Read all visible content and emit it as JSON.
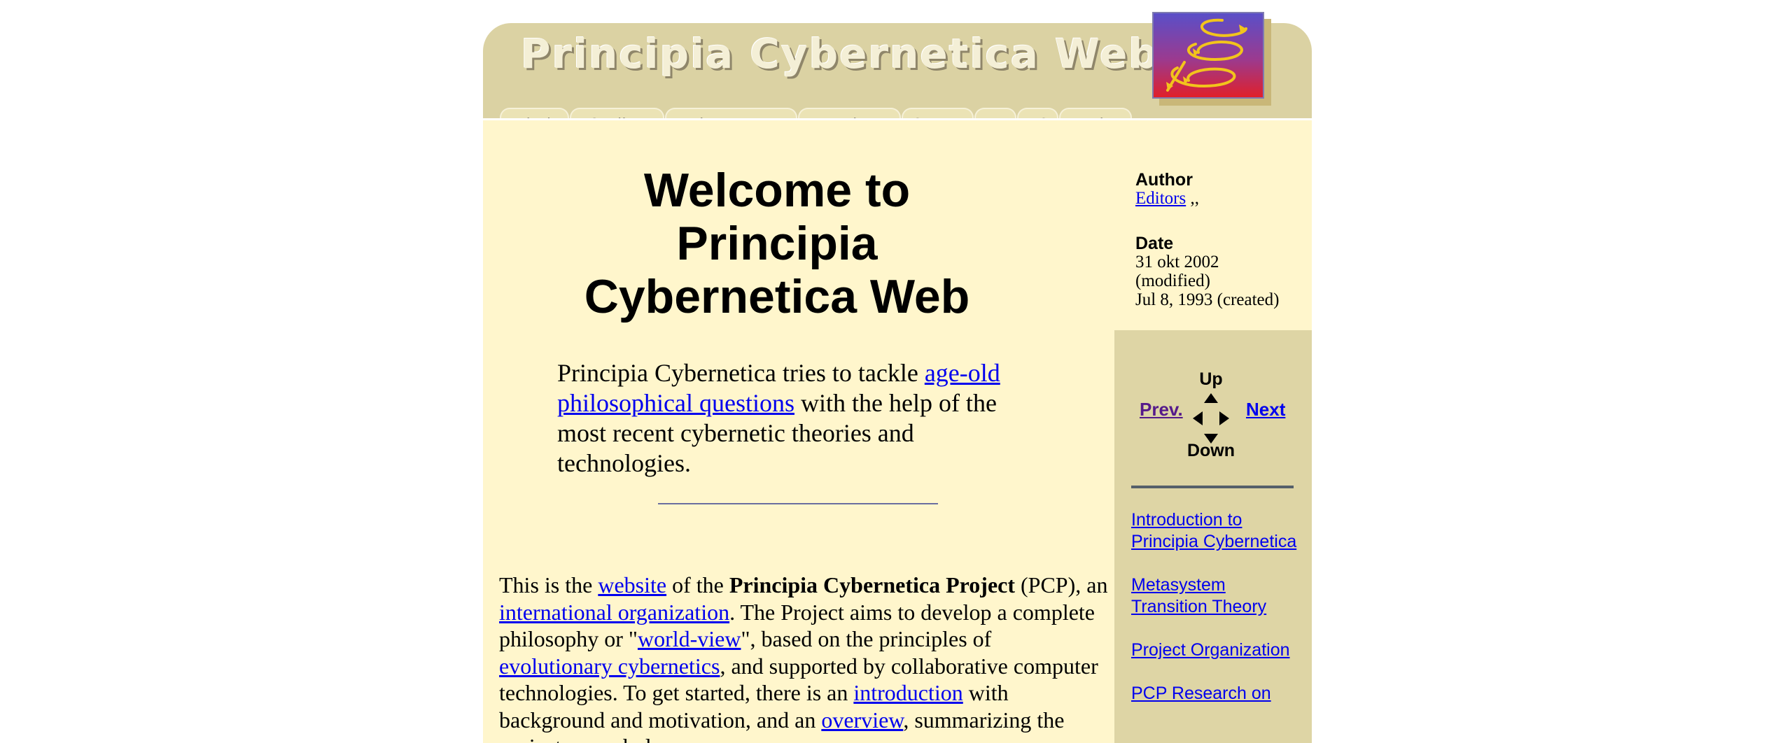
{
  "header": {
    "banner_title": "Principia Cybernetica Web",
    "tabs": [
      {
        "label": "Find",
        "style": "normal"
      },
      {
        "label": "Outline",
        "style": "normal"
      },
      {
        "label": "What's New",
        "style": "normal"
      },
      {
        "label": "Random",
        "style": "normal"
      },
      {
        "label": "Server",
        "style": "italic"
      },
      {
        "label": "EU",
        "style": "small"
      },
      {
        "label": "US",
        "style": "small"
      },
      {
        "label": "Help",
        "style": "normal"
      }
    ]
  },
  "main": {
    "title": "Welcome to Principia Cybernetica Web",
    "quote": {
      "before": "Principia Cybernetica tries to tackle ",
      "link": "age-old philosophical questions",
      "after": " with the help of the most recent cybernetic theories and technologies."
    },
    "body": {
      "t1": "This is the ",
      "l1": "website",
      "t2": " of the ",
      "b1": "Principia Cybernetica Project",
      "t3": " (PCP), an ",
      "l2": "international organization",
      "t4": ". The Project aims to develop a complete philosophy or \"",
      "l3": "world-view",
      "t5": "\", based on the principles of ",
      "l4": "evolutionary cybernetics",
      "t6": ", and supported by collaborative computer technologies. To get started, there is an ",
      "l5": "introduction",
      "t7": " with background and motivation, and an ",
      "l6": "overview",
      "t8": ", summarizing the project as a whole."
    }
  },
  "sidebar": {
    "author_label": "Author",
    "author_link": "Editors",
    "author_suffix": ",,",
    "date_label": "Date",
    "date_modified": "31 okt 2002",
    "modified_note": "(modified)",
    "date_created": "Jul 8, 1993 (created)",
    "nav": {
      "up": "Up",
      "down": "Down",
      "prev": "Prev.",
      "next": "Next"
    },
    "links": [
      "Introduction to Principia Cybernetica",
      "Metasystem Transition Theory",
      "Project Organization",
      "PCP Research on"
    ]
  },
  "colors": {
    "banner": "#dbd2a3",
    "content_bg": "#fff6cc",
    "sidebar_nav_bg": "#ded5a5",
    "link": "#0000ee",
    "visited_link": "#551a8b",
    "logo_gradient_top": "#5a4fc8",
    "logo_gradient_bottom": "#e0202a",
    "logo_arrows": "#f2c41c"
  },
  "icons": {
    "logo": "looping-arrows-logo",
    "navigation": "four-way-arrow-pad"
  }
}
